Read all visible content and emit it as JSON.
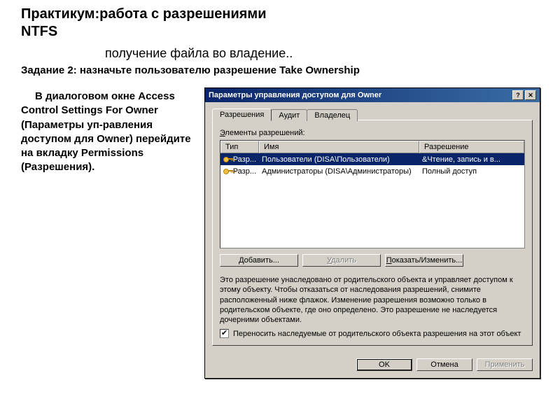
{
  "slide": {
    "title": "Практикум:работа с разрешениями NTFS",
    "subtitle": "получение файла во владение..",
    "task": "Задание 2: назначьте пользователю разрешение Take Ownership",
    "body": "В диалоговом окне Access Control Settings For Owner (Параметры уп-равления доступом для Owner) перейдите на вкладку Permissions (Разрешения)."
  },
  "dialog": {
    "title": "Параметры управления доступом для Owner",
    "tabs": [
      "Разрешения",
      "Аудит",
      "Владелец"
    ],
    "elements_label": "Элементы разрешений:",
    "columns": {
      "type": "Тип",
      "name": "Имя",
      "perm": "Разрешение"
    },
    "rows": [
      {
        "type": "Разр...",
        "name": "Пользователи (DISA\\Пользователи)",
        "perm": "&Чтение, запись и в..."
      },
      {
        "type": "Разр...",
        "name": "Администраторы (DISA\\Администраторы)",
        "perm": "Полный доступ"
      }
    ],
    "buttons": {
      "add": "Добавить...",
      "remove": "Удалить",
      "view": "Показать/Изменить..."
    },
    "info": "Это разрешение унаследовано от родительского объекта и управляет доступом к этому объекту. Чтобы отказаться от наследования разрешений, снимите расположенный ниже флажок. Изменение разрешения возможно только в родительском объекте, где оно определено. Это разрешение не наследуется дочерними объектами.",
    "inherit": "Переносить наследуемые от родительского объекта разрешения на этот объект",
    "footer": {
      "ok": "OK",
      "cancel": "Отмена",
      "apply": "Применить"
    }
  }
}
